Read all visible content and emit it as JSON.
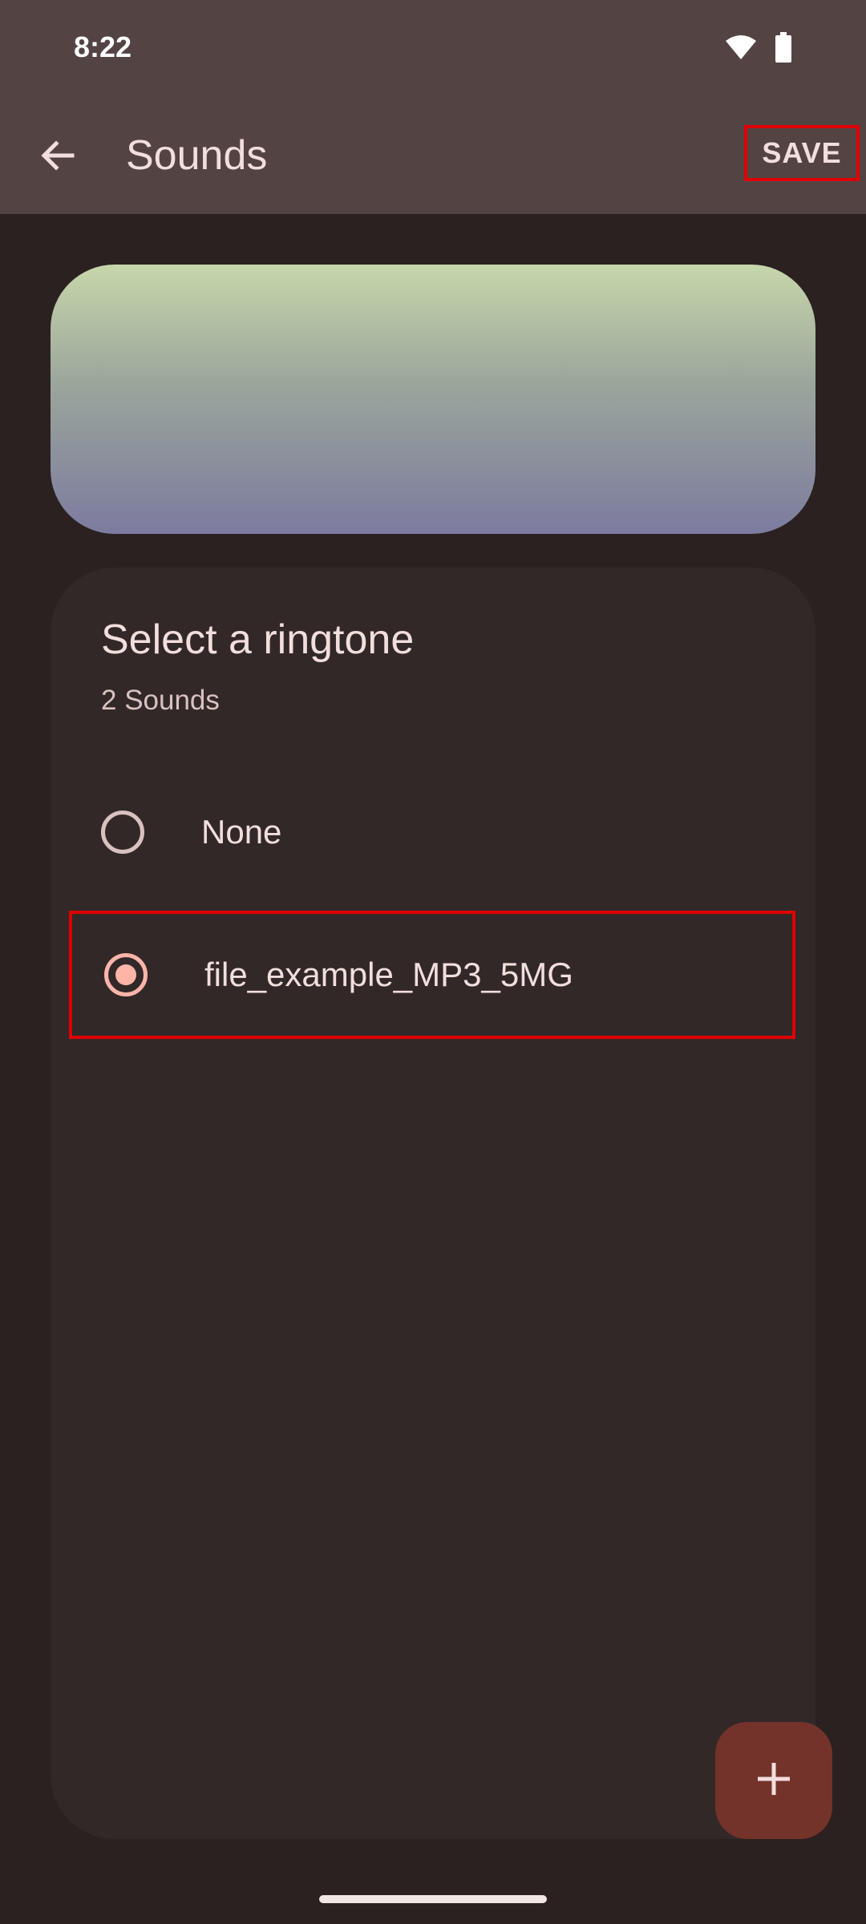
{
  "status_bar": {
    "time": "8:22",
    "icons": [
      "wifi-icon",
      "battery-icon"
    ]
  },
  "app_bar": {
    "title": "Sounds",
    "back_icon": "arrow-back-icon",
    "save_label": "SAVE"
  },
  "card": {
    "title": "Select a ringtone",
    "subtitle": "2 Sounds",
    "options": [
      {
        "label": "None",
        "selected": false
      },
      {
        "label": "file_example_MP3_5MG",
        "selected": true
      }
    ]
  },
  "fab": {
    "icon": "plus-icon"
  },
  "colors": {
    "app_bar_bg": "#534443",
    "background": "#2a2120",
    "card_bg": "#322828",
    "accent": "#ffb4a8",
    "fab_bg": "#73332a",
    "highlight_border": "#e00000"
  }
}
